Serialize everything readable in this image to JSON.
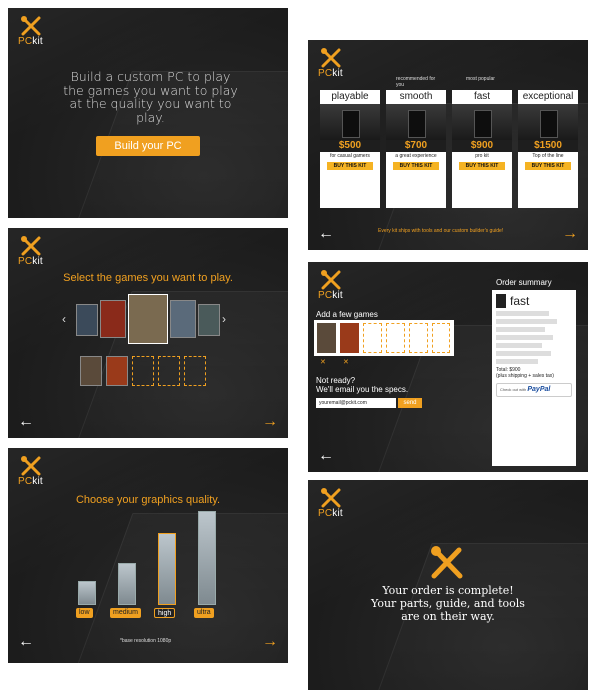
{
  "brand": {
    "logo_a": "PC",
    "logo_b": "kit"
  },
  "colors": {
    "accent": "#f0a020",
    "bg": "#1f1f1f"
  },
  "icons": {
    "back": "←",
    "forward": "→",
    "tools": "crossed-tools-icon"
  },
  "screen1": {
    "hero": "Build a custom PC to play the games you want to play at the quality you want to play.",
    "cta": "Build your PC"
  },
  "screen2": {
    "annotation_recommended": "recommended for you",
    "annotation_popular": "most popular",
    "kits": [
      {
        "name": "playable",
        "price": "$500",
        "sub": "for casual gamers",
        "buy": "BUY THIS KIT"
      },
      {
        "name": "smooth",
        "price": "$700",
        "sub": "a great experience",
        "buy": "BUY THIS KIT"
      },
      {
        "name": "fast",
        "price": "$900",
        "sub": "pro kit",
        "buy": "BUY THIS KIT"
      },
      {
        "name": "exceptional",
        "price": "$1500",
        "sub": "Top of the line",
        "buy": "BUY THIS KIT"
      }
    ],
    "footer": "Every kit ships with tools and our custom builder's guide!"
  },
  "screen3": {
    "title": "Select the games you want to play."
  },
  "screen4": {
    "add_title": "Add a few games",
    "ready": "Not ready?",
    "email_prompt": "We'll email you the specs.",
    "email_value": "youremail@pckit.com",
    "send": "send",
    "order_title": "Order summary",
    "kit_name": "fast",
    "total": "Total: $900",
    "total_note": "(plus shipping + sales tax)",
    "paypal_prefix": "Check out with",
    "paypal": "PayPal"
  },
  "screen5": {
    "title": "Choose your graphics quality.",
    "levels": [
      {
        "label": "low",
        "value": 0.22
      },
      {
        "label": "medium",
        "value": 0.38
      },
      {
        "label": "high",
        "value": 0.65
      },
      {
        "label": "ultra",
        "value": 0.85
      }
    ],
    "selected": "high",
    "note": "*base resolution 1080p"
  },
  "screen6": {
    "line1": "Your order is complete!",
    "line2": "Your parts, guide, and tools",
    "line3": "are on their way."
  }
}
